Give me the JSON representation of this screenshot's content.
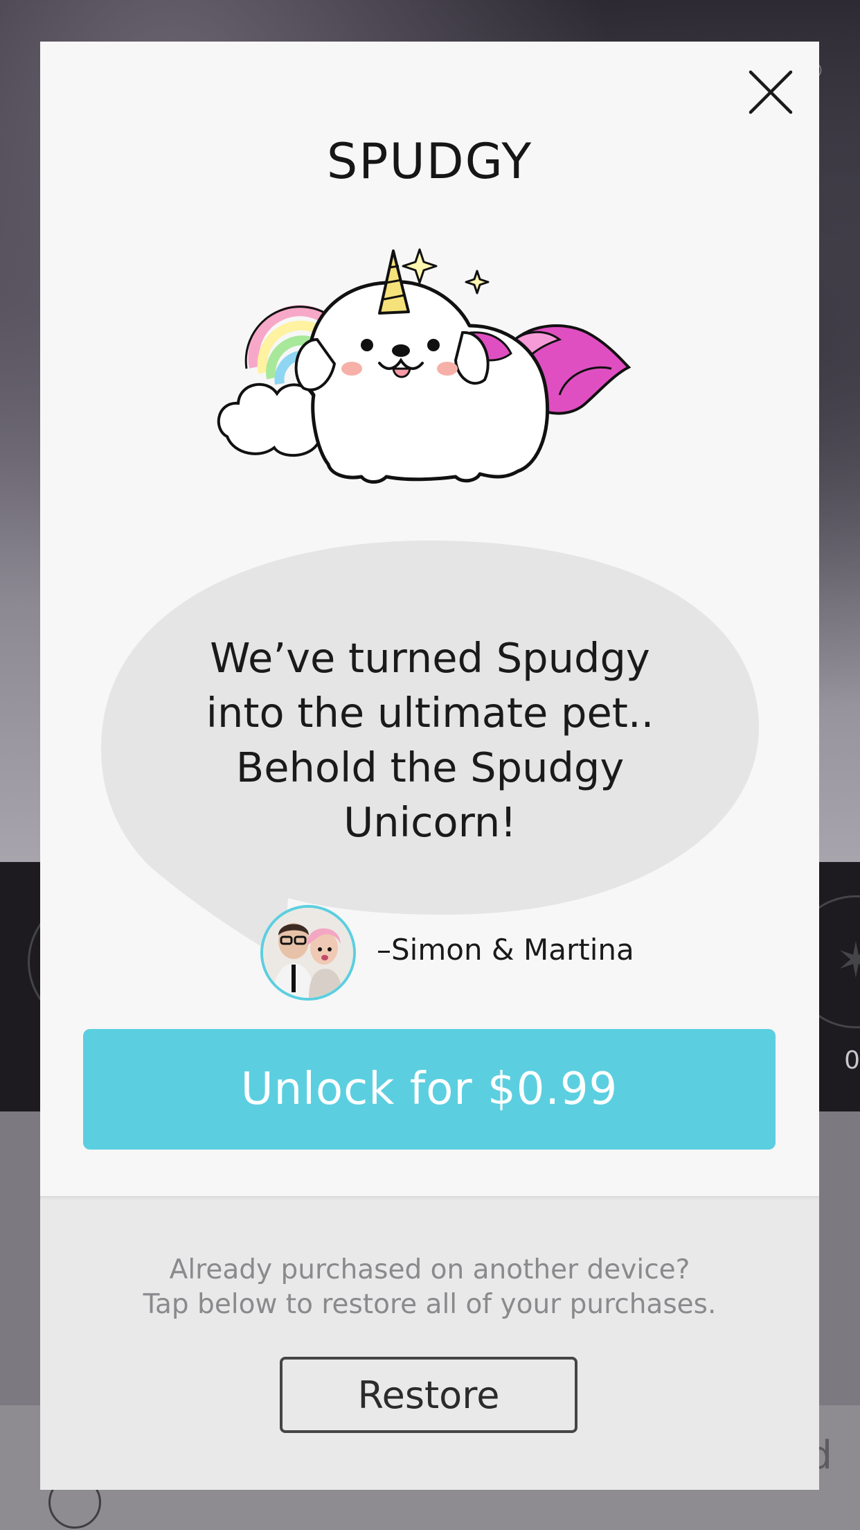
{
  "background": {
    "count_partial": "0",
    "done_partial": "d"
  },
  "modal": {
    "title": "SPUDGY",
    "message_lines": [
      "We’ve turned Spudgy",
      "into the ultimate pet..",
      "Behold the Spudgy",
      "Unicorn!"
    ],
    "signature": "–Simon & Martina",
    "unlock_label": "Unlock for $0.99",
    "restore_prompt_lines": [
      "Already purchased on another device?",
      "Tap below to restore all of your purchases."
    ],
    "restore_label": "Restore"
  },
  "colors": {
    "accent": "#5bcfe0",
    "bubble": "#e5e5e6",
    "modal_top": "#f7f7f7",
    "modal_bottom": "#e9e9ea"
  },
  "icons": {
    "close": "close-icon",
    "illustration": "spudgy-unicorn-illustration",
    "avatar": "simon-martina-avatar"
  }
}
